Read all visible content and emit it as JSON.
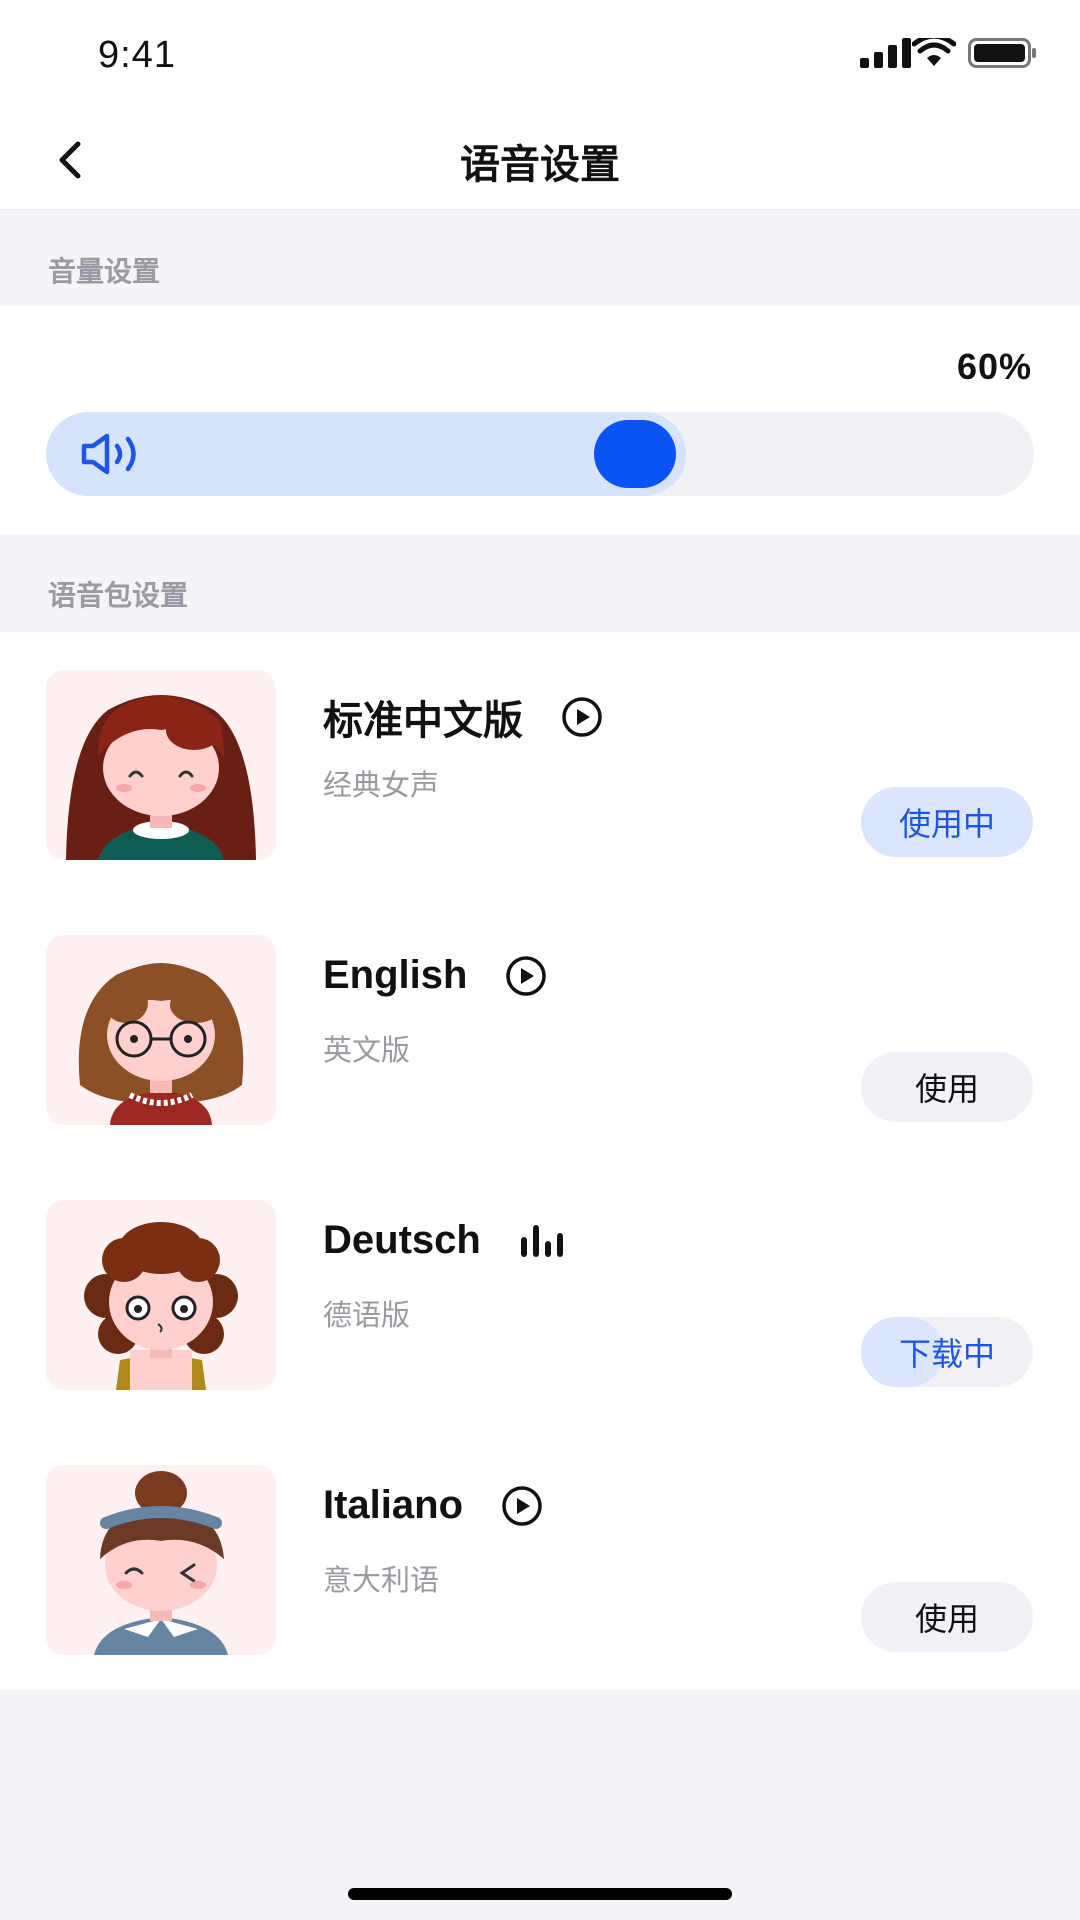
{
  "status_bar": {
    "time": "9:41"
  },
  "nav": {
    "title": "语音设置"
  },
  "volume_section": {
    "header": "音量设置",
    "percent_label": "60%",
    "level": 0.6
  },
  "voice_section": {
    "header": "语音包设置",
    "items": [
      {
        "name": "标准中文版",
        "subtitle": "经典女声",
        "button": "使用中",
        "state": "active",
        "icon": "play-circle-icon"
      },
      {
        "name": "English",
        "subtitle": "英文版",
        "button": "使用",
        "state": "default",
        "icon": "play-circle-icon"
      },
      {
        "name": "Deutsch",
        "subtitle": "德语版",
        "button": "下载中",
        "state": "downloading",
        "download_progress": 0.48,
        "icon": "audio-bars-icon"
      },
      {
        "name": "Italiano",
        "subtitle": "意大利语",
        "button": "使用",
        "state": "default",
        "icon": "play-circle-icon"
      }
    ]
  },
  "colors": {
    "accent": "#0a53f5",
    "accent_light": "#dbe6fc",
    "active_text": "#1c55e8",
    "muted": "#9a9aa2"
  }
}
